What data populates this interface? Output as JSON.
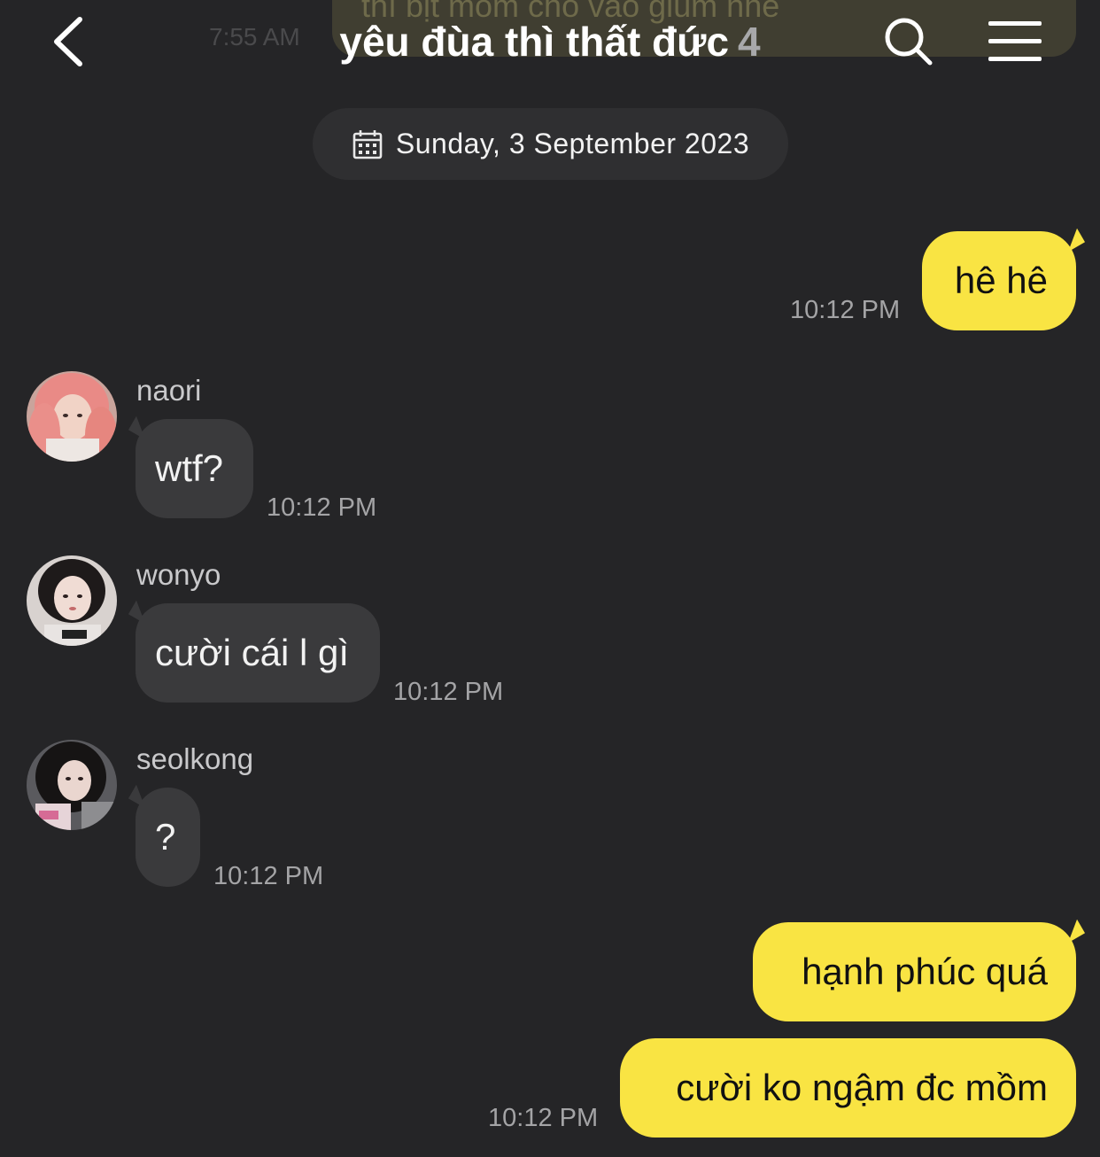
{
  "ghost": {
    "text": "thì bịt mồm chó vào giùm nhé",
    "time": "7:55 AM"
  },
  "header": {
    "title": "yêu đùa thì thất đức",
    "member_count": "4",
    "back_icon": "chevron-left-icon",
    "search_icon": "search-icon",
    "menu_icon": "hamburger-menu-icon"
  },
  "date_divider": {
    "icon": "calendar-icon",
    "label": "Sunday, 3 September 2023"
  },
  "messages": [
    {
      "direction": "out",
      "text": "hê hê",
      "time": "10:12 PM"
    },
    {
      "direction": "in",
      "sender": "naori",
      "text": "wtf?",
      "time": "10:12 PM"
    },
    {
      "direction": "in",
      "sender": "wonyo",
      "text": "cười cái l gì",
      "time": "10:12 PM"
    },
    {
      "direction": "in",
      "sender": "seolkong",
      "text": "?",
      "time": "10:12 PM"
    },
    {
      "direction": "out",
      "text": "hạnh phúc quá",
      "time": ""
    },
    {
      "direction": "out",
      "text": "cười ko ngậm đc mồm",
      "time": "10:12 PM"
    }
  ],
  "colors": {
    "background": "#252527",
    "outgoing_bubble": "#f9e443",
    "incoming_bubble": "#3a3a3c",
    "date_pill": "#2f2f31",
    "timestamp": "#a4a4a6"
  }
}
